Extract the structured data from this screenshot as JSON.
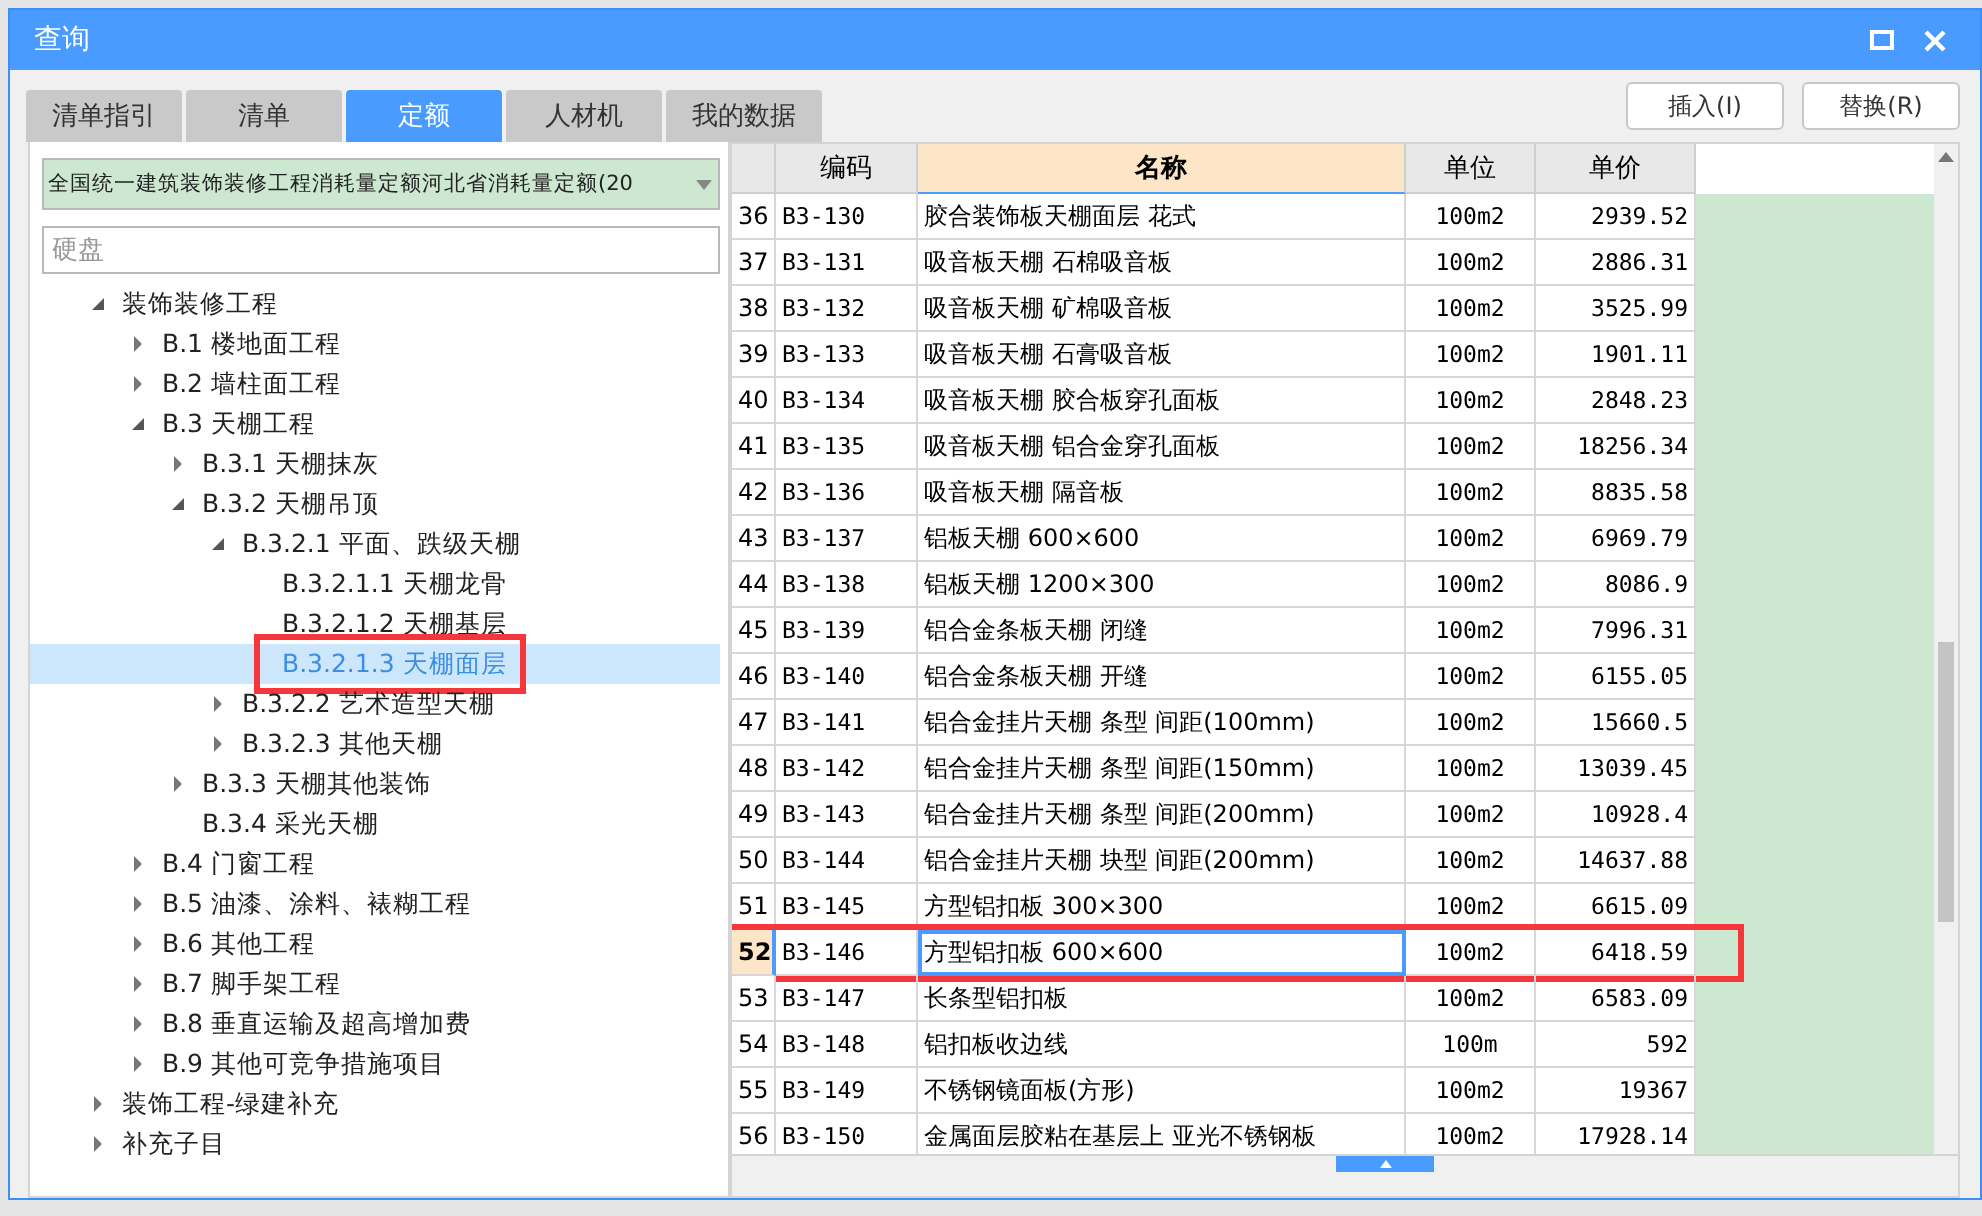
{
  "window": {
    "title": "查询"
  },
  "tabs": [
    {
      "label": "清单指引",
      "selected": false
    },
    {
      "label": "清单",
      "selected": false
    },
    {
      "label": "定额",
      "selected": true
    },
    {
      "label": "人材机",
      "selected": false
    },
    {
      "label": "我的数据",
      "selected": false
    }
  ],
  "buttons": [
    "插入(I)",
    "替换(R)"
  ],
  "library_select": {
    "value": "全国统一建筑装饰装修工程消耗量定额河北省消耗量定额(20"
  },
  "search": {
    "placeholder": "硬盘"
  },
  "tree": [
    {
      "label": "装饰装修工程",
      "expanded": true,
      "selected": false,
      "children": [
        {
          "label": "B.1 楼地面工程",
          "expanded": false,
          "selected": false
        },
        {
          "label": "B.2 墙柱面工程",
          "expanded": false,
          "selected": false
        },
        {
          "label": "B.3 天棚工程",
          "expanded": true,
          "selected": false,
          "children": [
            {
              "label": "B.3.1 天棚抹灰",
              "expanded": false,
              "selected": false
            },
            {
              "label": "B.3.2 天棚吊顶",
              "expanded": true,
              "selected": false,
              "children": [
                {
                  "label": "B.3.2.1 平面、跌级天棚",
                  "expanded": true,
                  "selected": false,
                  "children": [
                    {
                      "label": "B.3.2.1.1 天棚龙骨",
                      "selected": false
                    },
                    {
                      "label": "B.3.2.1.2 天棚基层",
                      "selected": false
                    },
                    {
                      "label": "B.3.2.1.3 天棚面层",
                      "selected": true
                    }
                  ]
                },
                {
                  "label": "B.3.2.2 艺术造型天棚",
                  "expanded": false,
                  "selected": false
                },
                {
                  "label": "B.3.2.3 其他天棚",
                  "expanded": false,
                  "selected": false
                }
              ]
            },
            {
              "label": "B.3.3 天棚其他装饰",
              "expanded": false,
              "selected": false
            },
            {
              "label": "B.3.4 采光天棚",
              "selected": false
            }
          ]
        },
        {
          "label": "B.4 门窗工程",
          "expanded": false,
          "selected": false
        },
        {
          "label": "B.5 油漆、涂料、裱糊工程",
          "expanded": false,
          "selected": false
        },
        {
          "label": "B.6 其他工程",
          "expanded": false,
          "selected": false
        },
        {
          "label": "B.7 脚手架工程",
          "expanded": false,
          "selected": false
        },
        {
          "label": "B.8 垂直运输及超高增加费",
          "expanded": false,
          "selected": false
        },
        {
          "label": "B.9 其他可竞争措施项目",
          "expanded": false,
          "selected": false
        }
      ]
    },
    {
      "label": "装饰工程-绿建补充",
      "expanded": false,
      "selected": false
    },
    {
      "label": "补充子目",
      "expanded": false,
      "selected": false
    }
  ],
  "table": {
    "columns": [
      "编码",
      "名称",
      "单位",
      "单价"
    ],
    "rows": [
      {
        "no": "36",
        "code": "B3-130",
        "name": "胶合装饰板天棚面层 花式",
        "unit": "100m2",
        "price": "2939.52",
        "selected": false
      },
      {
        "no": "37",
        "code": "B3-131",
        "name": "吸音板天棚 石棉吸音板",
        "unit": "100m2",
        "price": "2886.31",
        "selected": false
      },
      {
        "no": "38",
        "code": "B3-132",
        "name": "吸音板天棚 矿棉吸音板",
        "unit": "100m2",
        "price": "3525.99",
        "selected": false
      },
      {
        "no": "39",
        "code": "B3-133",
        "name": "吸音板天棚 石膏吸音板",
        "unit": "100m2",
        "price": "1901.11",
        "selected": false
      },
      {
        "no": "40",
        "code": "B3-134",
        "name": "吸音板天棚 胶合板穿孔面板",
        "unit": "100m2",
        "price": "2848.23",
        "selected": false
      },
      {
        "no": "41",
        "code": "B3-135",
        "name": "吸音板天棚 铝合金穿孔面板",
        "unit": "100m2",
        "price": "18256.34",
        "selected": false
      },
      {
        "no": "42",
        "code": "B3-136",
        "name": "吸音板天棚 隔音板",
        "unit": "100m2",
        "price": "8835.58",
        "selected": false
      },
      {
        "no": "43",
        "code": "B3-137",
        "name": "铝板天棚 600×600",
        "unit": "100m2",
        "price": "6969.79",
        "selected": false
      },
      {
        "no": "44",
        "code": "B3-138",
        "name": "铝板天棚 1200×300",
        "unit": "100m2",
        "price": "8086.9",
        "selected": false
      },
      {
        "no": "45",
        "code": "B3-139",
        "name": "铝合金条板天棚 闭缝",
        "unit": "100m2",
        "price": "7996.31",
        "selected": false
      },
      {
        "no": "46",
        "code": "B3-140",
        "name": "铝合金条板天棚 开缝",
        "unit": "100m2",
        "price": "6155.05",
        "selected": false
      },
      {
        "no": "47",
        "code": "B3-141",
        "name": "铝合金挂片天棚 条型 间距(100mm)",
        "unit": "100m2",
        "price": "15660.5",
        "selected": false
      },
      {
        "no": "48",
        "code": "B3-142",
        "name": "铝合金挂片天棚 条型 间距(150mm)",
        "unit": "100m2",
        "price": "13039.45",
        "selected": false
      },
      {
        "no": "49",
        "code": "B3-143",
        "name": "铝合金挂片天棚 条型 间距(200mm)",
        "unit": "100m2",
        "price": "10928.4",
        "selected": false
      },
      {
        "no": "50",
        "code": "B3-144",
        "name": "铝合金挂片天棚 块型 间距(200mm)",
        "unit": "100m2",
        "price": "14637.88",
        "selected": false
      },
      {
        "no": "51",
        "code": "B3-145",
        "name": "方型铝扣板 300×300",
        "unit": "100m2",
        "price": "6615.09",
        "selected": false
      },
      {
        "no": "52",
        "code": "B3-146",
        "name": "方型铝扣板 600×600",
        "unit": "100m2",
        "price": "6418.59",
        "selected": true
      },
      {
        "no": "53",
        "code": "B3-147",
        "name": "长条型铝扣板",
        "unit": "100m2",
        "price": "6583.09",
        "selected": false
      },
      {
        "no": "54",
        "code": "B3-148",
        "name": "铝扣板收边线",
        "unit": "100m",
        "price": "592",
        "selected": false
      },
      {
        "no": "55",
        "code": "B3-149",
        "name": "不锈钢镜面板(方形)",
        "unit": "100m2",
        "price": "19367",
        "selected": false
      },
      {
        "no": "56",
        "code": "B3-150",
        "name": "金属面层胶粘在基层上 亚光不锈钢板",
        "unit": "100m2",
        "price": "17928.14",
        "selected": false
      }
    ]
  }
}
